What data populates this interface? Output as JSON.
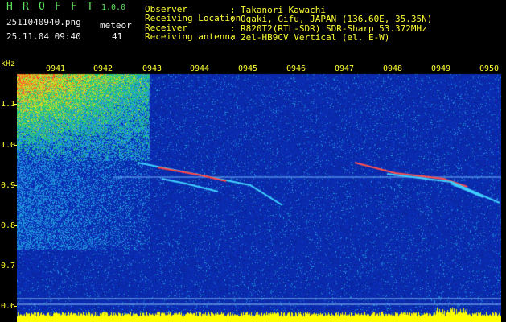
{
  "header": {
    "title_letters": [
      "H",
      "R",
      "O",
      "F",
      "F",
      "T"
    ],
    "version": "1.0.0",
    "filename": "2511040940.png",
    "datetime": "25.11.04 09:40",
    "meteor_label": "meteor",
    "meteor_count": "41",
    "info": [
      {
        "label": "Observer",
        "value": "Takanori Kawachi"
      },
      {
        "label": "Receiving Location",
        "value": "Ogaki, Gifu, JAPAN (136.60E, 35.35N)"
      },
      {
        "label": "Receiver",
        "value": "R820T2(RTL-SDR) SDR-Sharp 53.372MHz"
      },
      {
        "label": "Receiving antenna",
        "value": "2el-HB9CV Vertical (el. E-W)"
      }
    ]
  },
  "axis": {
    "unit": "kHz",
    "y_ticks": [
      "1.1",
      "1.0",
      "0.9",
      "0.8",
      "0.7",
      "0.6"
    ],
    "minutes": [
      "0941",
      "0942",
      "0943",
      "0944",
      "0945",
      "0946",
      "0947",
      "0948",
      "0949",
      "0950"
    ]
  },
  "colors": {
    "background_noise": "#0a1a8a",
    "signal_cyan": "#40d0ff",
    "signal_red": "#ff3030",
    "audio_bar": "#ffff00",
    "text_green": "#5fe35f",
    "text_yellow": "#ffff33"
  }
}
